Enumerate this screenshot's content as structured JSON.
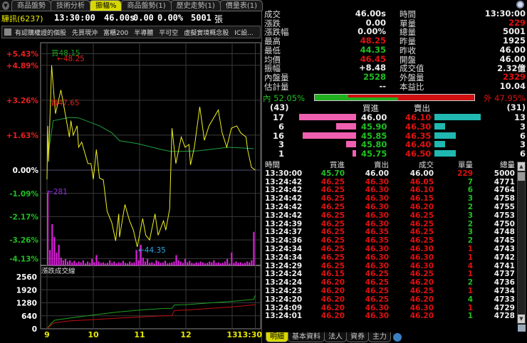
{
  "tabs": [
    "商品盤勢",
    "技術分析",
    "振幅%",
    "商品盤勢(1)",
    "歷史走勢(1)",
    "價量表(1)"
  ],
  "active_tab": 2,
  "stock": {
    "name": "驊訊(6237)",
    "time": "13:30:00",
    "price": "46.00s",
    "change": "0.00",
    "change_pct": "0.00%",
    "volume": "5001",
    "volume_unit": "張"
  },
  "filters": [
    "有認購權證的個股",
    "先買現沖",
    "富櫃200",
    "半導體",
    "平可空",
    "虛擬實境概念股",
    "IC設..."
  ],
  "quote_left": [
    {
      "label": "成交",
      "value": "46.00s",
      "color": "white"
    },
    {
      "label": "漲跌",
      "value": "0.00",
      "color": "white"
    },
    {
      "label": "漲跌幅",
      "value": "0.00%",
      "color": "white"
    },
    {
      "label": "最高",
      "value": "48.25",
      "color": "red"
    },
    {
      "label": "最低",
      "value": "44.35",
      "color": "green"
    },
    {
      "label": "均價",
      "value": "46.45",
      "color": "red"
    },
    {
      "label": "振幅",
      "value": "+8.48",
      "color": "white"
    },
    {
      "label": "內盤量",
      "value": "2528",
      "color": "green"
    },
    {
      "label": "估計量",
      "value": "--",
      "color": "white"
    }
  ],
  "quote_right": [
    {
      "label": "時間",
      "value": "13:30:00",
      "color": "white"
    },
    {
      "label": "單量",
      "value": "229",
      "color": "red"
    },
    {
      "label": "總量",
      "value": "5001",
      "color": "white"
    },
    {
      "label": "昨量",
      "value": "1925",
      "color": "white"
    },
    {
      "label": "昨收",
      "value": "46.00",
      "color": "white"
    },
    {
      "label": "開盤",
      "value": "46.00",
      "color": "white"
    },
    {
      "label": "成交值",
      "value": "2.32億",
      "color": "white"
    },
    {
      "label": "外盤量",
      "value": "2329",
      "color": "red"
    },
    {
      "label": "本益比",
      "value": "10.04",
      "color": "white"
    }
  ],
  "ratio": {
    "inner_label": "內 52.05%",
    "outer_label": "外 47.95%",
    "inner_pct": 52.05,
    "outer_pct": 47.95
  },
  "orderbook": {
    "bid_total": "(43)",
    "ask_total": "(31)",
    "bid_header": "買進",
    "ask_header": "賣出",
    "rows": [
      {
        "bid_qty": "17",
        "bid": "46.00",
        "bid_color": "white",
        "ask": "46.10",
        "ask_qty": "13"
      },
      {
        "bid_qty": "6",
        "bid": "45.90",
        "bid_color": "green",
        "ask": "46.30",
        "ask_qty": "3"
      },
      {
        "bid_qty": "16",
        "bid": "45.85",
        "bid_color": "green",
        "ask": "46.35",
        "ask_qty": "6"
      },
      {
        "bid_qty": "3",
        "bid": "45.80",
        "bid_color": "green",
        "ask": "46.40",
        "ask_qty": "3"
      },
      {
        "bid_qty": "1",
        "bid": "45.75",
        "bid_color": "green",
        "ask": "46.50",
        "ask_qty": "6"
      }
    ]
  },
  "ticks": {
    "headers": [
      "時間",
      "買進",
      "賣出",
      "成交",
      "單量",
      "總量"
    ],
    "rows": [
      [
        "13:30:00",
        "45.70",
        "46.00",
        "46.00",
        "229",
        "5000"
      ],
      [
        "13:24:42",
        "46.25",
        "46.30",
        "46.05",
        "7",
        "4771"
      ],
      [
        "13:24:42",
        "46.25",
        "46.30",
        "46.10",
        "6",
        "4764"
      ],
      [
        "13:24:42",
        "46.25",
        "46.30",
        "46.15",
        "3",
        "4758"
      ],
      [
        "13:24:42",
        "46.25",
        "46.30",
        "46.20",
        "2",
        "4755"
      ],
      [
        "13:24:42",
        "46.25",
        "46.30",
        "46.25",
        "3",
        "4753"
      ],
      [
        "13:24:39",
        "46.25",
        "46.30",
        "46.25",
        "2",
        "4750"
      ],
      [
        "13:24:37",
        "46.25",
        "46.35",
        "46.25",
        "3",
        "4748"
      ],
      [
        "13:24:36",
        "46.25",
        "46.35",
        "46.25",
        "2",
        "4745"
      ],
      [
        "13:24:34",
        "46.25",
        "46.30",
        "46.30",
        "1",
        "4743"
      ],
      [
        "13:24:34",
        "46.25",
        "46.30",
        "46.30",
        "1",
        "4742"
      ],
      [
        "13:24:29",
        "46.25",
        "46.30",
        "46.30",
        "4",
        "4741"
      ],
      [
        "13:24:24",
        "46.15",
        "46.25",
        "46.25",
        "1",
        "4737"
      ],
      [
        "13:24:24",
        "46.20",
        "46.25",
        "46.20",
        "2",
        "4736"
      ],
      [
        "13:24:23",
        "46.20",
        "46.25",
        "46.25",
        "1",
        "4734"
      ],
      [
        "13:24:20",
        "46.20",
        "46.25",
        "46.20",
        "4",
        "4733"
      ],
      [
        "13:24:09",
        "46.20",
        "46.30",
        "46.30",
        "1",
        "4729"
      ],
      [
        "13:24:01",
        "46.20",
        "46.30",
        "46.20",
        "1",
        "4728"
      ]
    ],
    "qty_colors": [
      "red",
      "green",
      "green",
      "green",
      "green",
      "green",
      "green",
      "green",
      "green",
      "red",
      "red",
      "red",
      "red",
      "green",
      "red",
      "green",
      "red",
      "green"
    ]
  },
  "bottom_tabs": [
    "明細",
    "基本資料",
    "法人",
    "資券",
    "主力"
  ],
  "chart_data": {
    "type": "line",
    "ref_price": 46.0,
    "y_ticks": [
      "+5.43%",
      "+4.89%",
      "+3.26%",
      "+1.63%",
      "0.00%",
      "-1.09%",
      "-2.17%",
      "-3.26%",
      "-4.13%"
    ],
    "y_tick_values": [
      5.43,
      4.89,
      3.26,
      1.63,
      0,
      -1.09,
      -2.17,
      -3.26,
      -4.13
    ],
    "x_ticks": [
      "9",
      "10",
      "11",
      "12",
      "13",
      "13:30"
    ],
    "x_tick_minutes": [
      0,
      60,
      120,
      180,
      240,
      270
    ],
    "price_series": {
      "minutes": [
        0,
        1,
        2,
        6,
        8,
        11,
        18,
        22,
        29,
        31,
        34,
        39,
        41,
        45,
        53,
        57,
        60,
        64,
        68,
        73,
        78,
        84,
        89,
        93,
        94,
        101,
        107,
        112,
        117,
        124,
        128,
        133,
        140,
        144,
        151,
        154,
        159,
        162,
        167,
        174,
        179,
        184,
        186,
        191,
        198,
        204,
        210,
        222,
        227,
        233,
        239,
        246,
        251,
        258,
        260,
        265,
        270
      ],
      "prices": [
        45.8,
        46.95,
        46.18,
        48.25,
        47.82,
        47.21,
        47.72,
        47.36,
        46.71,
        47.06,
        46.75,
        46.95,
        46.49,
        46.6,
        46.14,
        46.14,
        45.8,
        46.44,
        45.83,
        45.79,
        45.11,
        44.87,
        44.48,
        45.06,
        44.56,
        45.26,
        44.91,
        44.71,
        44.35,
        44.96,
        44.6,
        44.5,
        45.06,
        44.6,
        44.91,
        44.71,
        45.17,
        46.9,
        46.14,
        46.71,
        46.49,
        46.55,
        46.11,
        46.49,
        47.36,
        46.64,
        46.95,
        47.29,
        46.8,
        46.49,
        46.9,
        46.95,
        46.8,
        46.71,
        46.44,
        46.06,
        46.0
      ]
    },
    "avg_series": {
      "minutes": [
        2,
        8,
        29,
        41,
        68,
        84,
        94,
        117,
        149,
        161,
        195,
        235,
        268
      ],
      "prices": [
        46.4,
        47.06,
        47.13,
        47.12,
        46.95,
        46.8,
        46.63,
        46.57,
        46.44,
        46.4,
        46.41,
        46.49,
        46.46
      ]
    },
    "volume_bars": [
      281,
      60,
      160,
      110,
      50,
      80,
      30,
      20,
      25,
      15,
      20,
      12,
      18,
      10,
      15,
      12,
      20,
      8,
      15,
      10,
      25,
      12,
      40,
      15,
      10,
      12,
      8,
      10,
      20,
      10,
      15,
      8,
      12,
      10,
      18,
      10,
      8,
      15,
      10,
      12,
      60,
      20,
      80,
      30,
      15,
      25,
      10,
      12,
      8,
      20,
      15,
      10,
      12,
      18,
      8,
      10,
      12,
      15,
      40,
      20,
      15,
      10,
      25,
      12,
      18,
      10,
      8,
      12,
      10,
      15,
      12,
      8,
      10,
      15,
      12,
      20,
      10,
      12,
      8,
      10,
      15,
      25,
      8,
      50,
      10,
      15,
      10,
      12,
      8,
      10,
      15,
      12,
      20,
      130
    ],
    "annotations": {
      "buy": "買48.15",
      "high": "←48.25",
      "sell": "賣47.65",
      "low": "←44.35",
      "max_vol": "←281"
    },
    "lower": {
      "title": "漲跌成交線",
      "y_ticks": [
        "2560",
        "1920",
        "1280",
        "640",
        "0"
      ],
      "y_tick_values": [
        2560,
        1920,
        1280,
        640,
        0
      ],
      "minutes": [
        0,
        5,
        10,
        30,
        60,
        90,
        120,
        150,
        162,
        165,
        180,
        210,
        240,
        268,
        270
      ],
      "series": [
        {
          "name": "up",
          "color": "#20a020",
          "values": [
            0,
            250,
            420,
            530,
            680,
            820,
            920,
            1000,
            1010,
            1170,
            1190,
            1270,
            1350,
            1450,
            1650
          ]
        },
        {
          "name": "down",
          "color": "#c01010",
          "values": [
            0,
            180,
            300,
            390,
            450,
            520,
            580,
            640,
            650,
            900,
            920,
            1000,
            1080,
            1180,
            1180
          ]
        }
      ]
    }
  }
}
